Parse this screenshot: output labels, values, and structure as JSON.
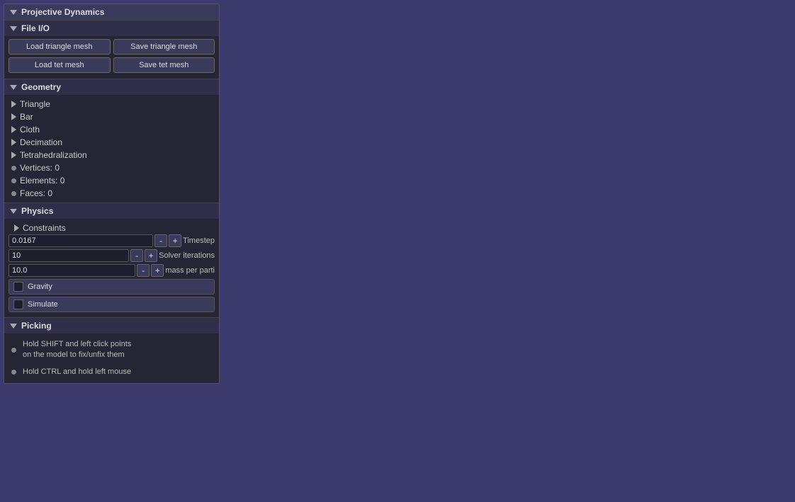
{
  "background_color": "#3d3b6e",
  "panel": {
    "title": "Projective Dynamics",
    "sections": {
      "file_io": {
        "label": "File I/O",
        "buttons": {
          "load_triangle": "Load triangle mesh",
          "save_triangle": "Save triangle mesh",
          "load_tet": "Load tet mesh",
          "save_tet": "Save tet mesh"
        }
      },
      "geometry": {
        "label": "Geometry",
        "tree_items": [
          {
            "label": "Triangle"
          },
          {
            "label": "Bar"
          },
          {
            "label": "Cloth"
          },
          {
            "label": "Decimation"
          },
          {
            "label": "Tetrahedralization"
          }
        ],
        "stats": [
          {
            "label": "Vertices: 0"
          },
          {
            "label": "Elements: 0"
          },
          {
            "label": "Faces: 0"
          }
        ]
      },
      "physics": {
        "label": "Physics",
        "constraints_label": "Constraints",
        "params": [
          {
            "value": "0.0167",
            "label": "Timestep"
          },
          {
            "value": "10",
            "label": "Solver iterations"
          },
          {
            "value": "10.0",
            "label": "mass per parti"
          }
        ],
        "buttons": {
          "gravity": "Gravity",
          "simulate": "Simulate"
        }
      },
      "picking": {
        "label": "Picking",
        "instructions": [
          "Hold SHIFT and left click points on the model to fix/unfix them",
          "Hold CTRL and hold left mouse"
        ]
      }
    }
  }
}
